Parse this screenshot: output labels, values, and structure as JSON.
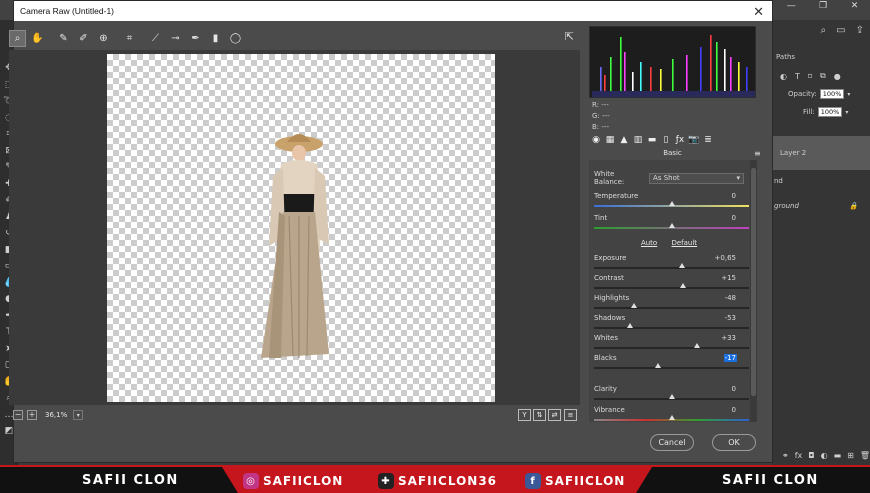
{
  "dialog": {
    "title": "Camera Raw (Untitled-1)",
    "close_glyph": "✕"
  },
  "toolbar": {
    "tools": [
      "zoom-tool-icon",
      "hand-tool-icon",
      "white-balance-tool-icon",
      "color-sampler-tool-icon",
      "targeted-adjustment-tool-icon",
      "crop-tool-icon",
      "straighten-tool-icon",
      "spot-removal-tool-icon",
      "red-eye-tool-icon",
      "adjustment-brush-icon",
      "graduated-filter-icon",
      "radial-filter-icon"
    ]
  },
  "preview": {
    "zoom_level": "36,1%",
    "zoom_out_label": "−",
    "zoom_in_label": "+"
  },
  "histogram": {
    "r_label": "R:",
    "r_value": "---",
    "g_label": "G:",
    "g_value": "---",
    "b_label": "B:",
    "b_value": "---"
  },
  "panel": {
    "title": "Basic",
    "white_balance_label": "White Balance:",
    "white_balance_value": "As Shot",
    "auto_label": "Auto",
    "default_label": "Default",
    "sliders": [
      {
        "label": "Temperature",
        "value": "0",
        "position": 0.5
      },
      {
        "label": "Tint",
        "value": "0",
        "position": 0.5
      },
      {
        "label": "Exposure",
        "value": "+0,65",
        "position": 0.565
      },
      {
        "label": "Contrast",
        "value": "+15",
        "position": 0.575
      },
      {
        "label": "Highlights",
        "value": "-48",
        "position": 0.26
      },
      {
        "label": "Shadows",
        "value": "-53",
        "position": 0.235
      },
      {
        "label": "Whites",
        "value": "+33",
        "position": 0.665
      },
      {
        "label": "Blacks",
        "value": "-17",
        "position": 0.415
      },
      {
        "label": "Clarity",
        "value": "0",
        "position": 0.5
      },
      {
        "label": "Vibrance",
        "value": "0",
        "position": 0.5
      }
    ]
  },
  "buttons": {
    "cancel": "Cancel",
    "ok": "OK"
  },
  "photoshop": {
    "paths_tab": "Paths",
    "opacity_label": "Opacity:",
    "opacity_value": "100%",
    "fill_label": "Fill:",
    "fill_value": "100%",
    "layer2_name": "Layer 2",
    "layer_partial": "nd",
    "background_name": "ground"
  },
  "banner": {
    "left_name": "SAFII CLON",
    "instagram": "SAFIICLON",
    "other": "SAFIICLON36",
    "facebook": "SAFIICLON",
    "right_name": "SAFII CLON"
  },
  "colors": {
    "accent_highlight": "#1a6fdc",
    "banner_red": "#c4161c"
  }
}
